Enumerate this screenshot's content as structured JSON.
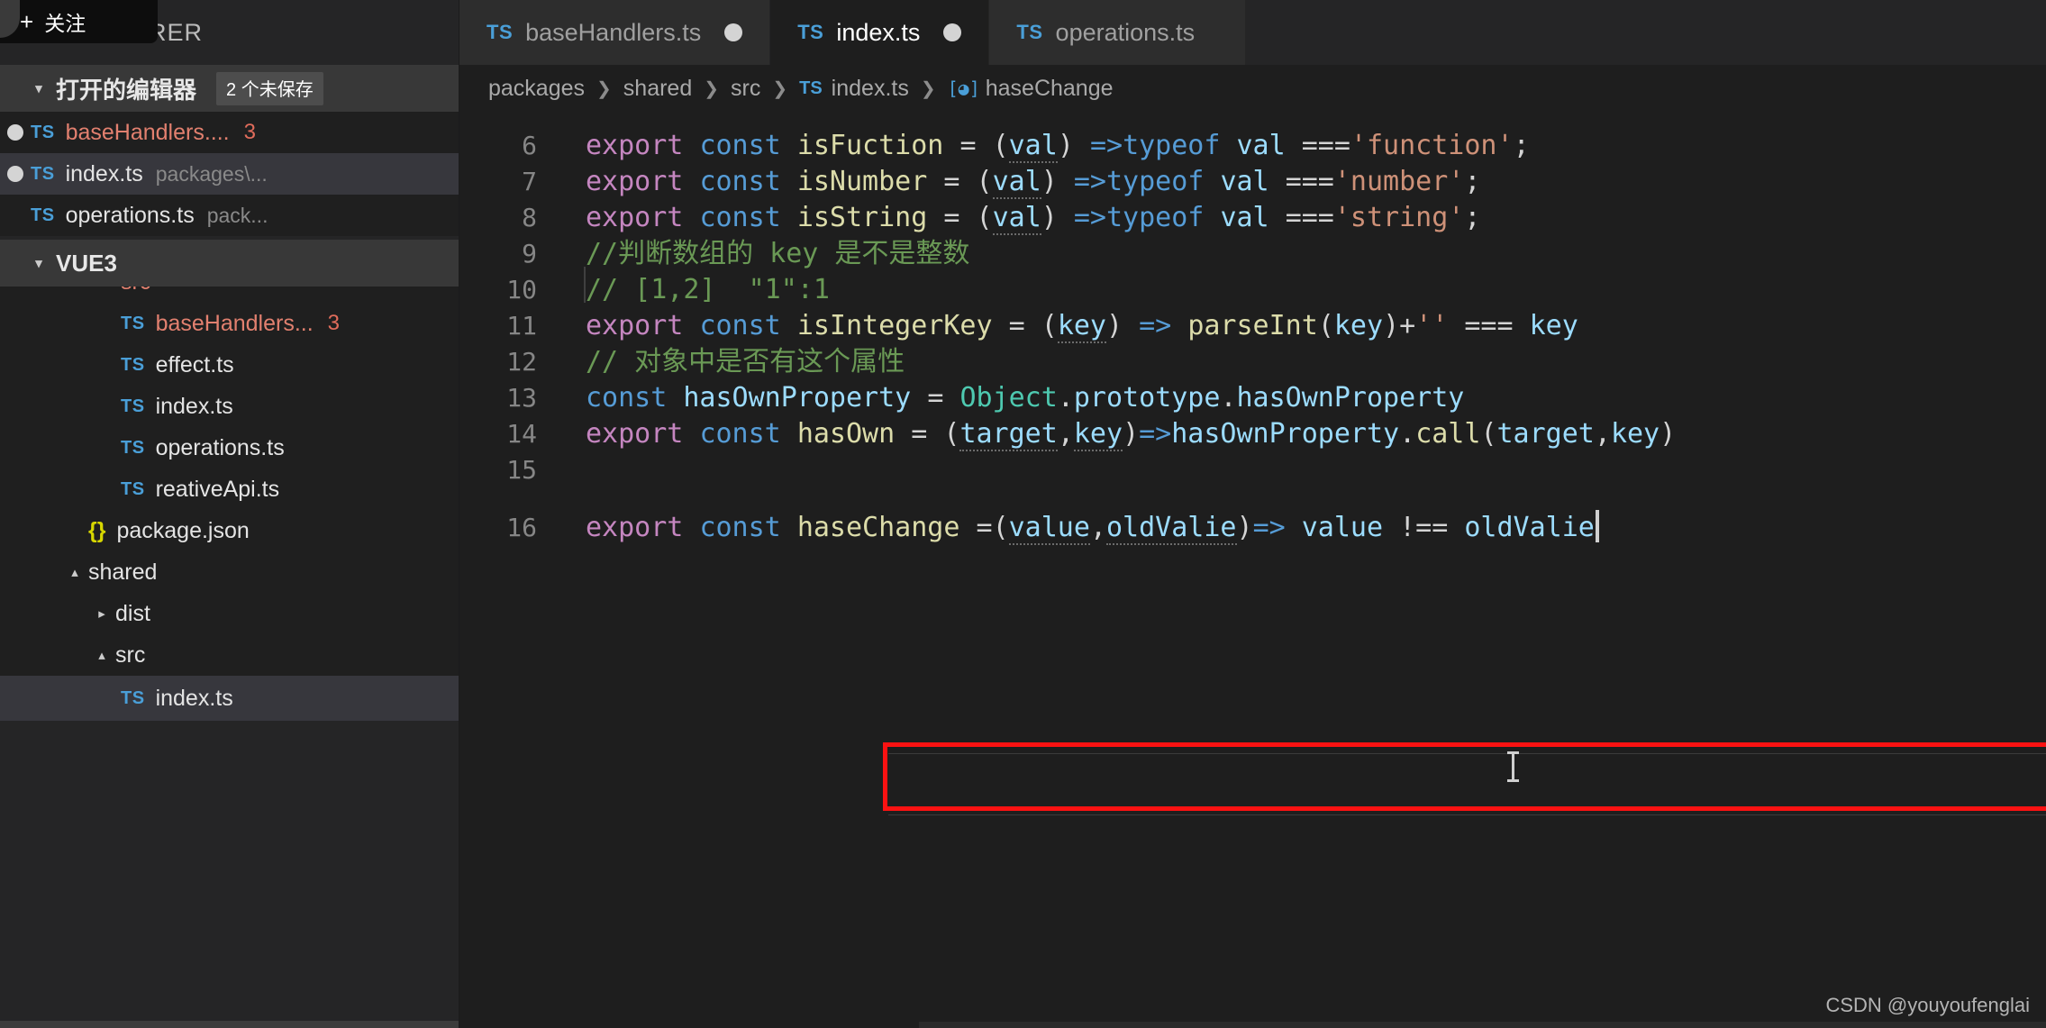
{
  "overlay": {
    "follow_plus": "+",
    "follow_label": "关注"
  },
  "sidebar": {
    "title": "EXPLORER",
    "open_editors": {
      "label": "打开的编辑器",
      "badge": "2 个未保存",
      "items": [
        {
          "dirty": true,
          "icon": "ts-icon",
          "name": "baseHandlers....",
          "desc": "",
          "errors": "3",
          "selected": false,
          "modified": true
        },
        {
          "dirty": true,
          "icon": "ts-icon",
          "name": "index.ts",
          "desc": "packages\\...",
          "errors": "",
          "selected": true,
          "modified": false
        },
        {
          "dirty": false,
          "icon": "ts-icon",
          "name": "operations.ts",
          "desc": "pack...",
          "errors": "",
          "selected": false,
          "modified": false
        }
      ]
    },
    "project": {
      "label": "VUE3",
      "items": [
        {
          "indent": 2,
          "icon": "folder-open",
          "name": "src",
          "twisty": "▴",
          "clipped": true,
          "modified": true
        },
        {
          "indent": 3,
          "icon": "ts-icon",
          "name": "baseHandlers...",
          "errors": "3",
          "modified": true
        },
        {
          "indent": 3,
          "icon": "ts-icon",
          "name": "effect.ts",
          "errors": "",
          "modified": false
        },
        {
          "indent": 3,
          "icon": "ts-icon",
          "name": "index.ts",
          "errors": "",
          "modified": false
        },
        {
          "indent": 3,
          "icon": "ts-icon",
          "name": "operations.ts",
          "errors": "",
          "modified": false
        },
        {
          "indent": 3,
          "icon": "ts-icon",
          "name": "reativeApi.ts",
          "errors": "",
          "modified": false
        },
        {
          "indent": 2,
          "icon": "json-icon",
          "name": "package.json",
          "errors": "",
          "modified": false
        },
        {
          "indent": 1,
          "icon": "folder-open",
          "name": "shared",
          "twisty": "▴",
          "modified": false
        },
        {
          "indent": 2,
          "icon": "folder-closed",
          "name": "dist",
          "twisty": "▸",
          "modified": false
        },
        {
          "indent": 2,
          "icon": "folder-open",
          "name": "src",
          "twisty": "▴",
          "modified": false
        },
        {
          "indent": 3,
          "icon": "ts-icon",
          "name": "index.ts",
          "errors": "",
          "selected": true,
          "modified": false
        }
      ]
    }
  },
  "tabs": [
    {
      "icon": "ts-icon",
      "label": "baseHandlers.ts",
      "dirty": true,
      "active": false
    },
    {
      "icon": "ts-icon",
      "label": "index.ts",
      "dirty": true,
      "active": true
    },
    {
      "icon": "ts-icon",
      "label": "operations.ts",
      "dirty": false,
      "active": false
    }
  ],
  "breadcrumb": {
    "separator": "❯",
    "items": [
      "packages",
      "shared",
      "src",
      "index.ts",
      "haseChange"
    ],
    "file_icon": "ts-icon",
    "symbol_icon": "symbol-variable-icon"
  },
  "editor": {
    "first_visible_line": 6,
    "lines": [
      {
        "n": "6",
        "text": "export const isFuction = (val) =>typeof val ==='function';"
      },
      {
        "n": "7",
        "text": "export const isNumber = (val) =>typeof val ==='number';"
      },
      {
        "n": "8",
        "text": "export const isString = (val) =>typeof val ==='string';"
      },
      {
        "n": "9",
        "text": "//判断数组的 key 是不是整数"
      },
      {
        "n": "10",
        "text": "// [1,2]  \"1\":1"
      },
      {
        "n": "11",
        "text": "export const isIntegerKey = (key) => parseInt(key)+'' === key"
      },
      {
        "n": "12",
        "text": "// 对象中是否有这个属性"
      },
      {
        "n": "13",
        "text": "const hasOwnProperty = Object.prototype.hasOwnProperty"
      },
      {
        "n": "14",
        "text": "export const hasOwn = (target,key)=>hasOwnProperty.call(target,key)"
      },
      {
        "n": "15",
        "text": ""
      },
      {
        "n": "16",
        "text": "export const haseChange =(value,oldValie)=> value !== oldValie"
      }
    ],
    "highlight_line": "16",
    "highlight_color": "#fb1212"
  },
  "watermark": "CSDN @youyoufenglai"
}
